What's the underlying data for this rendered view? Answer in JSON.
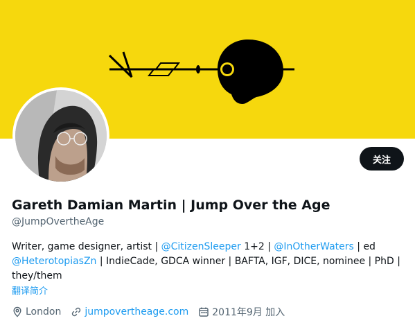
{
  "profile": {
    "name": "Gareth Damian Martin | Jump Over the Age",
    "handle": "@JumpOvertheAge",
    "follow_label": "关注",
    "bio": {
      "t1": "Writer, game designer, artist | ",
      "l1": "@CitizenSleeper",
      "t2": " 1+2 | ",
      "l2": "@InOtherWaters",
      "t3": " | ed ",
      "l3": "@HeterotopiasZn",
      "t4": " | IndieCade, GDCA winner | BAFTA, IGF, DICE, nominee | PhD | they/them"
    },
    "translate_label": "翻译简介",
    "location": "London",
    "website": "jumpovertheage.com",
    "joined": "2011年9月 加入"
  },
  "colors": {
    "banner": "#f6d80d",
    "accent": "#1d9bf0",
    "text": "#0f1419",
    "secondary": "#536471"
  },
  "icons": {
    "location": "location-pin-icon",
    "website": "link-icon",
    "joined": "calendar-icon"
  }
}
